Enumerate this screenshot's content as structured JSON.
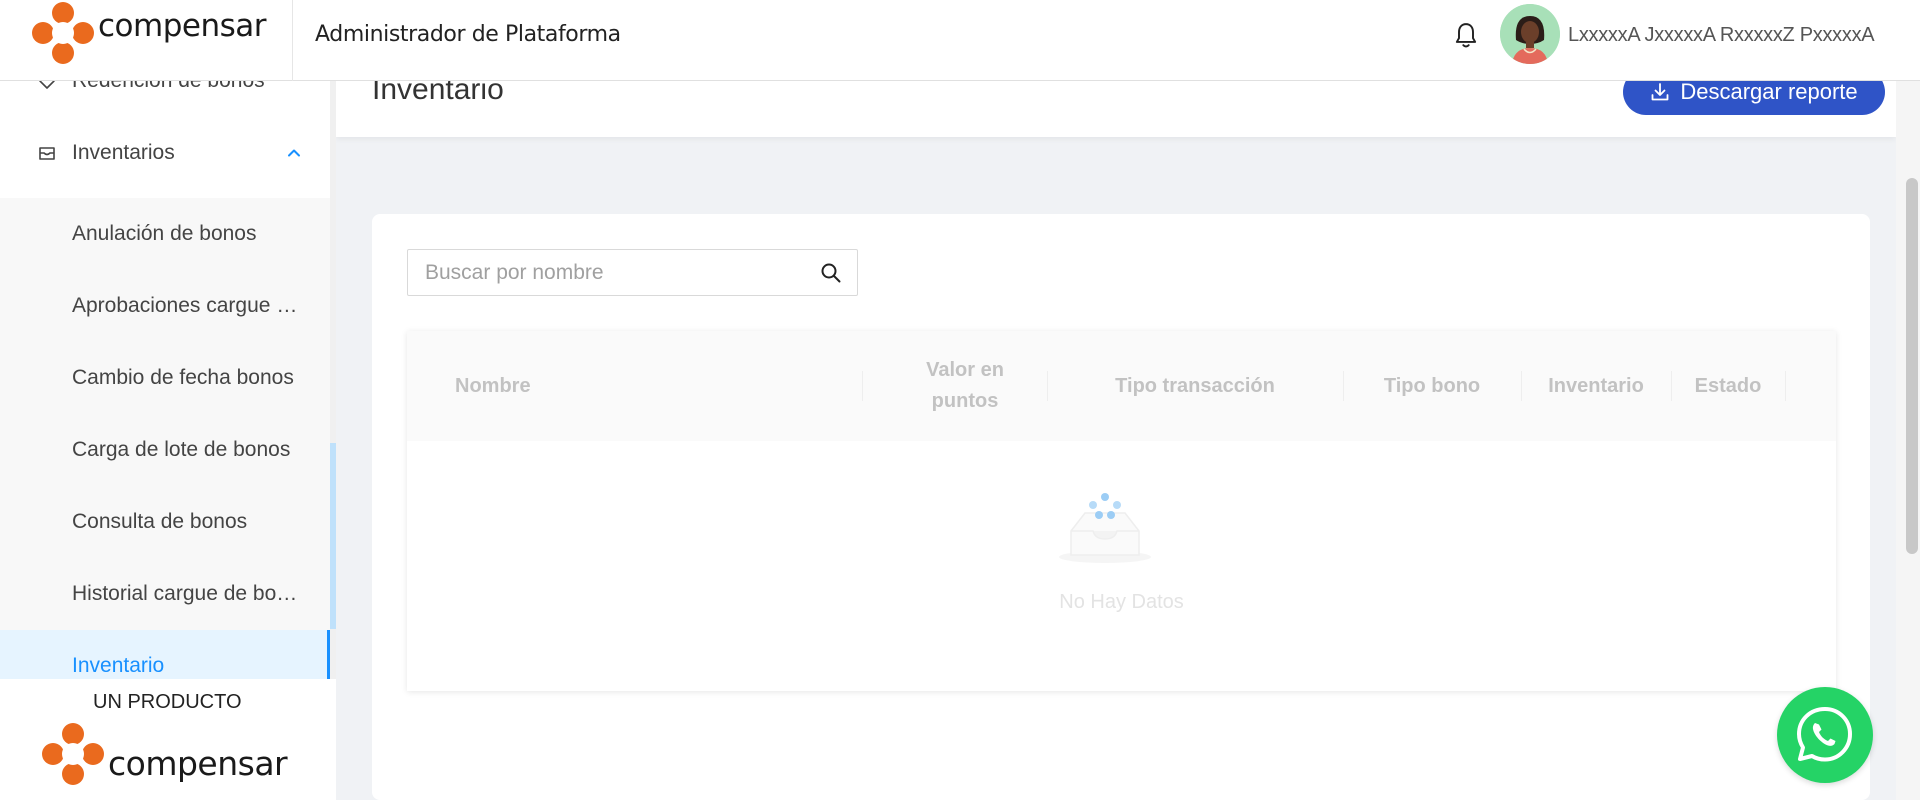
{
  "header": {
    "logo_text": "compensar",
    "app_title": "Administrador de Plataforma",
    "user_name": "LxxxxxA JxxxxxA RxxxxxZ PxxxxxA"
  },
  "sidebar": {
    "items": [
      {
        "label": "Redención de bonos",
        "icon": "tag-icon"
      },
      {
        "label": "Inventarios",
        "icon": "inbox-icon",
        "expanded": true
      }
    ],
    "submenu": [
      {
        "label": "Anulación de bonos"
      },
      {
        "label": "Aprobaciones cargue de bonos"
      },
      {
        "label": "Cambio de fecha bonos"
      },
      {
        "label": "Carga de lote de bonos"
      },
      {
        "label": "Consulta de bonos"
      },
      {
        "label": "Historial cargue de bonos"
      },
      {
        "label": "Inventario",
        "active": true
      }
    ],
    "footer_caption": "UN PRODUCTO",
    "footer_logo_text": "compensar"
  },
  "page": {
    "title": "Inventario",
    "download_label": "Descargar reporte"
  },
  "search": {
    "placeholder": "Buscar por nombre",
    "value": ""
  },
  "table": {
    "columns": [
      "Nombre",
      "Valor en puntos",
      "Tipo transacción",
      "Tipo bono",
      "Inventario",
      "Estado"
    ],
    "empty_text": "No Hay Datos"
  },
  "colors": {
    "brand_orange": "#ea6a1e",
    "primary_button": "#2f54c7",
    "active_link": "#1890ff",
    "whatsapp": "#25d366"
  }
}
